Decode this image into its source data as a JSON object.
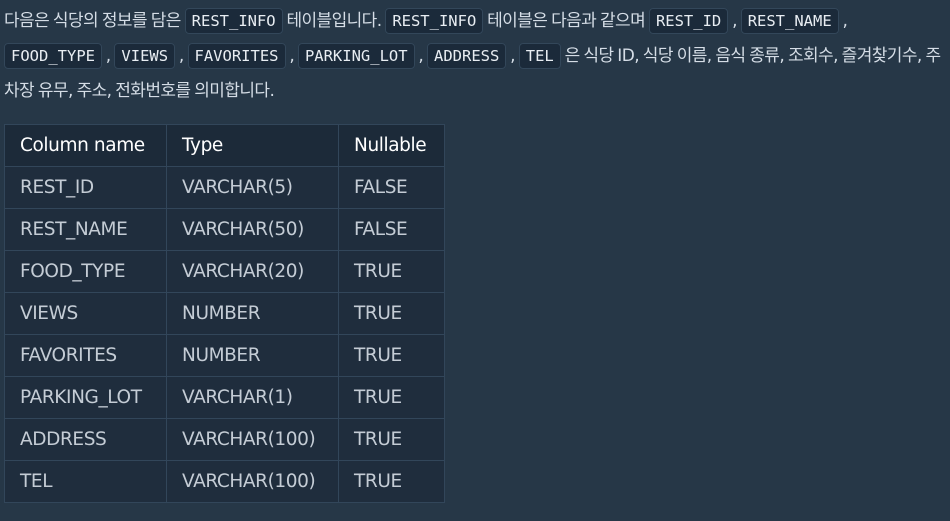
{
  "description": {
    "p1": "다음은 식당의 정보를 담은 ",
    "code1": "REST_INFO",
    "p2": " 테이블입니다. ",
    "code2": "REST_INFO",
    "p3": " 테이블은 다음과 같으며 ",
    "code3": "REST_ID",
    "sep1": " , ",
    "code4": "REST_NAME",
    "sep2": " , ",
    "code5": "FOOD_TYPE",
    "sep3": " , ",
    "code6": "VIEWS",
    "sep4": " , ",
    "code7": "FAVORITES",
    "sep5": " , ",
    "code8": "PARKING_LOT",
    "sep6": " , ",
    "code9": "ADDRESS",
    "sep7": " , ",
    "code10": "TEL",
    "p4": " 은 식당 ID, 식당 이름, 음식 종류, 조회수, 즐겨찾기수, 주차장 유무, 주소, 전화번호를 의미합니다."
  },
  "table": {
    "headers": [
      "Column name",
      "Type",
      "Nullable"
    ],
    "rows": [
      [
        "REST_ID",
        "VARCHAR(5)",
        "FALSE"
      ],
      [
        "REST_NAME",
        "VARCHAR(50)",
        "FALSE"
      ],
      [
        "FOOD_TYPE",
        "VARCHAR(20)",
        "TRUE"
      ],
      [
        "VIEWS",
        "NUMBER",
        "TRUE"
      ],
      [
        "FAVORITES",
        "NUMBER",
        "TRUE"
      ],
      [
        "PARKING_LOT",
        "VARCHAR(1)",
        "TRUE"
      ],
      [
        "ADDRESS",
        "VARCHAR(100)",
        "TRUE"
      ],
      [
        "TEL",
        "VARCHAR(100)",
        "TRUE"
      ]
    ]
  }
}
